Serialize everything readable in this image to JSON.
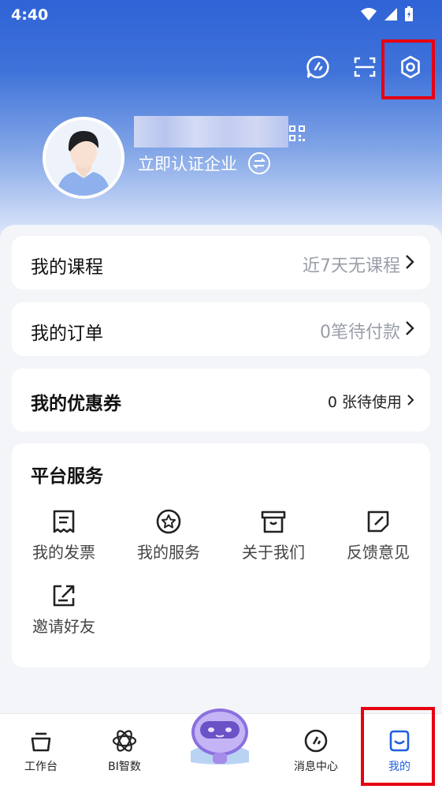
{
  "status_bar": {
    "time": "4:40"
  },
  "profile": {
    "cert_label": "立即认证企业"
  },
  "rows": {
    "course": {
      "title": "我的课程",
      "status": "近7天无课程"
    },
    "order": {
      "title": "我的订单",
      "status": "0笔待付款"
    },
    "coupon": {
      "title": "我的优惠券",
      "status": "0 张待使用"
    }
  },
  "services": {
    "title": "平台服务",
    "items": [
      {
        "label": "我的发票",
        "icon": "invoice-icon"
      },
      {
        "label": "我的服务",
        "icon": "star-circle-icon"
      },
      {
        "label": "关于我们",
        "icon": "store-icon"
      },
      {
        "label": "反馈意见",
        "icon": "edit-icon"
      },
      {
        "label": "邀请好友",
        "icon": "share-icon"
      }
    ]
  },
  "tabs": [
    {
      "label": "工作台",
      "icon": "workbench-icon"
    },
    {
      "label": "BI智数",
      "icon": "atom-icon"
    },
    {
      "label": "消息中心",
      "icon": "message-icon"
    },
    {
      "label": "我的",
      "icon": "profile-icon",
      "active": true
    }
  ],
  "colors": {
    "accent": "#1f5fe0",
    "highlight": "#e60012",
    "hero_top": "#2f63d6"
  }
}
